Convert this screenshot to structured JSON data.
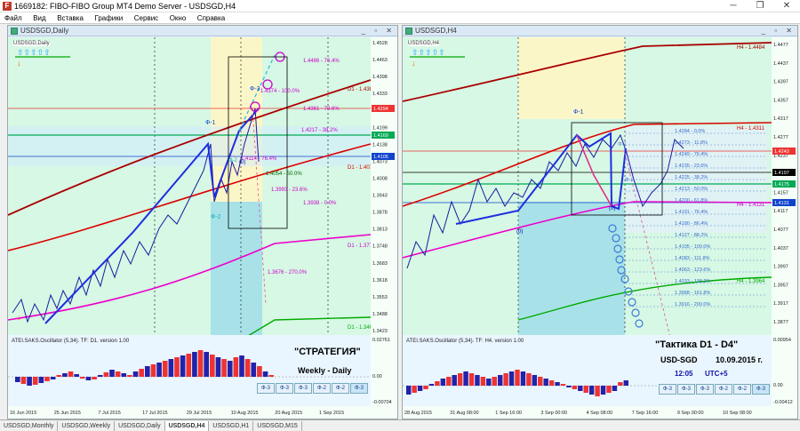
{
  "window": {
    "title": "1669182: FIBO-FIBO Group MT4 Demo Server - USDSGD,H4",
    "min": "─",
    "max": "❐",
    "close": "✕"
  },
  "menu": [
    "Файл",
    "Вид",
    "Вставка",
    "Графики",
    "Сервис",
    "Окно",
    "Справка"
  ],
  "left": {
    "title": "USDSGD,Daily",
    "osc_label": "ATEI.SAKS.Oscillator (5,34). TF: D1. version 1.00",
    "prices": [
      "1.4528",
      "1.4463",
      "1.4398",
      "1.4333",
      "1.4268",
      "1.4199",
      "1.4138",
      "1.4073",
      "1.4008",
      "1.3943",
      "1.3878",
      "1.3813",
      "1.3748",
      "1.3683",
      "1.3618",
      "1.3553",
      "1.3488",
      "1.3423"
    ],
    "osc_vals": [
      "0.02761",
      "0.00",
      "-0.00704"
    ],
    "dates": [
      "16 Jun 2015",
      "25 Jun 2015",
      "7 Jul 2015",
      "17 Jul 2015",
      "29 Jul 2015",
      "10 Aug 2015",
      "20 Aug 2015",
      "1 Sep 2015"
    ],
    "fib": [
      "1.4486 - 76.4%",
      "1.4374 - 100.0%",
      "1.4361 - 78.6%",
      "1.4217 - 38.2%",
      "1.4114 - 76.4%",
      "1.4054 - 50.0%",
      "1.3993 - 23.6%",
      "1.3938 - 0.0%",
      "1.3676 - 270.0%"
    ],
    "levels": [
      "D1 - 1.4384",
      "D1 - 1.4076",
      "D1 - 1.3772",
      "D1 - 1.3466"
    ],
    "tags": [
      "1.4294",
      "1.4169",
      "1.4105"
    ],
    "waves": [
      "Ф-1",
      "Ф-2",
      "Ф-3",
      "Ф-2",
      "(0)"
    ],
    "strategy": "\"СТРАТЕГИЯ\"",
    "strategy_sub": "Weekly - Daily",
    "buttons": [
      "Ф-3",
      "Ф-3",
      "Ф-3",
      "Ф-2",
      "Ф-2",
      "Ф-3"
    ]
  },
  "right": {
    "title": "USDSGD,H4",
    "osc_label": "ATEI.SAKS.Oscillator (5,34). TF: H4. version 1.00",
    "prices": [
      "1.4477",
      "1.4437",
      "1.4397",
      "1.4357",
      "1.4317",
      "1.4277",
      "1.4237",
      "1.4197",
      "1.4157",
      "1.4117",
      "1.4077",
      "1.4037",
      "1.3997",
      "1.3957",
      "1.3917",
      "1.3877"
    ],
    "osc_vals": [
      "0.00954",
      "0.00",
      "-0.00412"
    ],
    "dates": [
      "28 Aug 2015",
      "31 Aug 08:00",
      "1 Sep 16:00",
      "3 Sep 00:00",
      "4 Sep 08:00",
      "7 Sep 16:00",
      "9 Sep 00:00",
      "10 Sep 08:00"
    ],
    "fib": [
      "1.4284 - 0.0%",
      "1.4273 - 11.8%",
      "1.4249 - 76.4%",
      "1.4235 - 23.6%",
      "1.4225 - 38.2%",
      "1.4213 - 50.0%",
      "1.4200 - 61.8%",
      "1.4191 - 76.4%",
      "1.4180 - 86.4%",
      "1.4127 - 88.2%",
      "1.4105 - 100.0%",
      "1.4083 - 111.8%",
      "1.4063 - 123.6%",
      "1.4033 - 138.2%",
      "1.3988 - 161.8%",
      "1.3916 - 200.0%"
    ],
    "levels": [
      "H4 - 1.4484",
      "H4 - 1.4311",
      "H4 - 1.4131",
      "H4 - 1.3964"
    ],
    "tags": [
      "1.4243",
      "1.4197",
      "1.4175",
      "1.4131"
    ],
    "waves": [
      "Ф-1",
      "Ф-1",
      "Ф-2",
      "(0)",
      "(0)"
    ],
    "tactic": "\"Тактика   D1 - D4\"",
    "pair": "USD-SGD",
    "date": "10.09.2015 г.",
    "time": "12:05",
    "tz": "UTC+5",
    "buttons": [
      "Ф-3",
      "Ф-3",
      "Ф-3",
      "Ф-2",
      "Ф-2",
      "Ф-3"
    ]
  },
  "tabs": [
    "USDSGD,Monthly",
    "USDSGD,Weekly",
    "USDSGD,Daily",
    "USDSGD,H4",
    "USDSGD,H1",
    "USDSGD,M15"
  ],
  "active_tab": "USDSGD,H4"
}
